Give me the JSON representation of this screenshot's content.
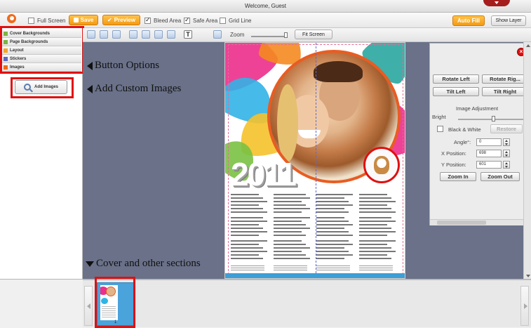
{
  "window": {
    "title": "Welcome, Guest"
  },
  "toolbar": {
    "full_screen": "Full Screen",
    "save": "Save",
    "preview": "Preview",
    "bleed_area": "Bleed Area",
    "safe_area": "Safe Area",
    "grid_line": "Grid Line",
    "auto_fill": "Auto Fill",
    "show_layer": "Show Layer",
    "zoom_label": "Zoom",
    "fit_screen": "Fit Screen",
    "bleed_checked": true,
    "safe_checked": true,
    "grid_checked": false,
    "fullscreen_checked": false,
    "zoom_level": 0.9
  },
  "sidebar": {
    "items": [
      {
        "label": "Cover Backgrounds",
        "icon": "folder-icon"
      },
      {
        "label": "Page Backgrounds",
        "icon": "folder-icon"
      },
      {
        "label": "Layout",
        "icon": "layout-icon"
      },
      {
        "label": "Stickers",
        "icon": "sticker-icon"
      },
      {
        "label": "Images",
        "icon": "image-icon"
      }
    ],
    "add_images": "Add Images"
  },
  "annotations": {
    "button_options": "Button Options",
    "add_custom_images": "Add Custom Images",
    "cover_sections": "Cover and other sections"
  },
  "canvas": {
    "year": "2011"
  },
  "properties": {
    "rotate_left": "Rotate Left",
    "rotate_right": "Rotate Rig...",
    "tilt_left": "Tilt Left",
    "tilt_right": "Tilt Right",
    "image_adjustment": "Image Adjustment",
    "bright": "Bright",
    "black_white": "Black & White",
    "restore": "Restore",
    "angle_label": "Angle°:",
    "angle_value": "0",
    "x_label": "X Position:",
    "x_value": "698",
    "y_label": "Y Position:",
    "y_value": "601",
    "zoom_in": "Zoom In",
    "zoom_out": "Zoom Out",
    "brightness_level": 0.5
  },
  "filmstrip": {
    "pages": [
      {
        "number": "1"
      }
    ]
  },
  "colors": {
    "accent_orange": "#f49a12",
    "highlight_red": "#e01010",
    "canvas_bg": "#6a7189",
    "thumb_blue": "#4aa3db"
  }
}
